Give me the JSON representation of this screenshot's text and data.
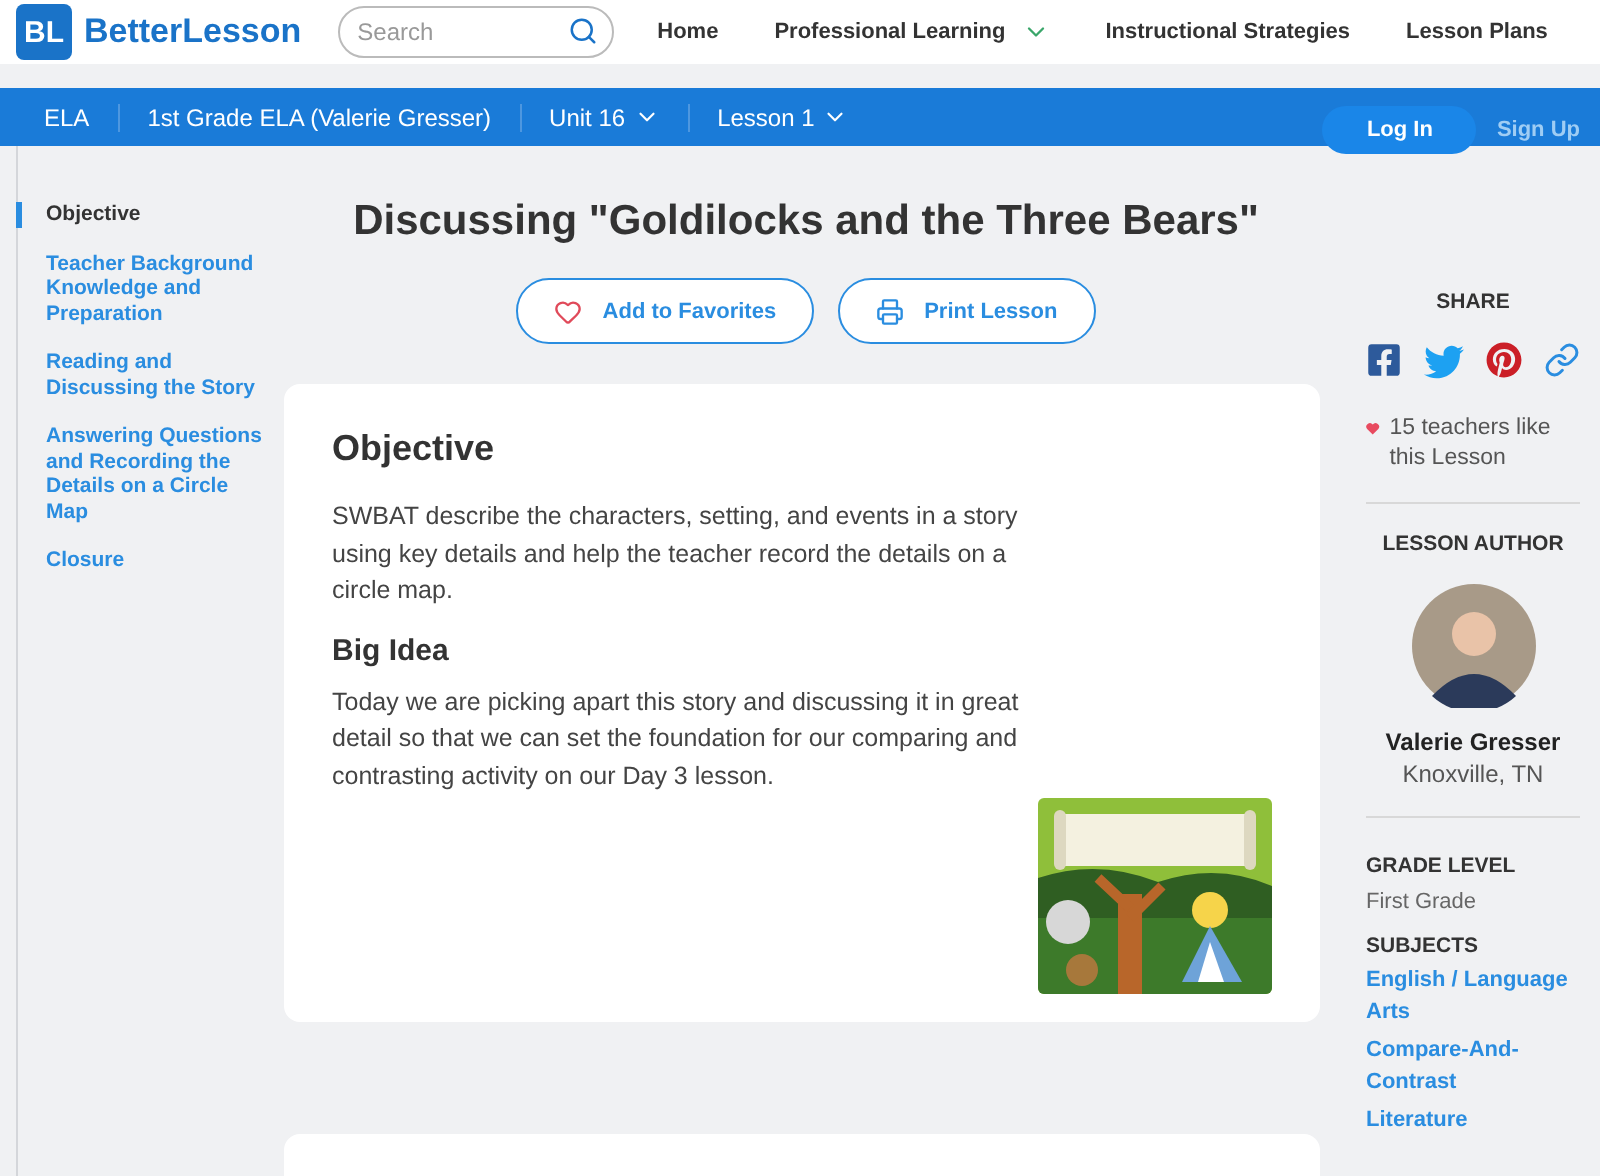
{
  "logo": {
    "mark": "BL",
    "name": "BetterLesson"
  },
  "search": {
    "placeholder": "Search"
  },
  "top_nav": [
    {
      "label": "Home",
      "has_menu": false
    },
    {
      "label": "Professional Learning",
      "has_menu": true
    },
    {
      "label": "Instructional Strategies",
      "has_menu": false
    },
    {
      "label": "Lesson Plans",
      "has_menu": false
    }
  ],
  "breadcrumb": [
    {
      "label": "ELA",
      "has_menu": false
    },
    {
      "label": "1st Grade ELA (Valerie Gresser)",
      "has_menu": false
    },
    {
      "label": "Unit 16",
      "has_menu": true
    },
    {
      "label": "Lesson 1",
      "has_menu": true
    }
  ],
  "auth": {
    "login": "Log In",
    "signup": "Sign Up"
  },
  "sidebar": {
    "items": [
      {
        "label": "Objective",
        "selected": true
      },
      {
        "label": "Teacher Background Knowledge and Preparation",
        "selected": false
      },
      {
        "label": "Reading and Discussing the Story",
        "selected": false
      },
      {
        "label": "Answering Questions and Recording the Details on a Circle Map",
        "selected": false
      },
      {
        "label": "Closure",
        "selected": false
      }
    ]
  },
  "lesson": {
    "title": "Discussing \"Goldilocks and the Three Bears\"",
    "actions": [
      {
        "kind": "favorite",
        "label": "Add to Favorites"
      },
      {
        "kind": "print",
        "label": "Print Lesson"
      }
    ],
    "sections": [
      {
        "heading": "Objective",
        "text": "SWBAT describe the characters, setting, and events in a story using key details and help the teacher record the details on a circle map."
      },
      {
        "heading": "Big Idea",
        "text": "Today we are picking apart this story and discussing it in great detail so that we can set the foundation for our comparing and contrasting activity on our Day 3 lesson."
      }
    ]
  },
  "details": {
    "share_label": "SHARE",
    "likes": "15 teachers like this Lesson",
    "author_label": "LESSON AUTHOR",
    "author_name": "Valerie Gresser",
    "author_location": "Knoxville, TN",
    "grade_label": "GRADE LEVEL",
    "grade": "First Grade",
    "subjects_label": "SUBJECTS",
    "subjects": [
      "English / Language Arts",
      "Compare-And-Contrast",
      "Literature"
    ]
  }
}
